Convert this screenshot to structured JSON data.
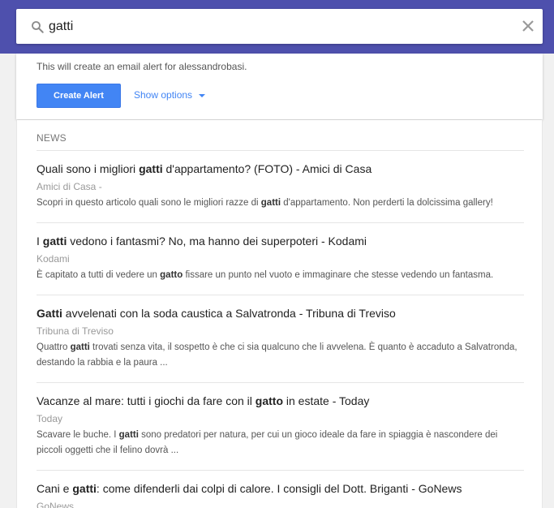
{
  "search": {
    "value": "gatti",
    "placeholder": ""
  },
  "alert": {
    "message": "This will create an email alert for alessandrobasi.",
    "create_label": "Create Alert",
    "options_label": "Show options"
  },
  "news": {
    "section_label": "NEWS",
    "items": [
      {
        "title": [
          {
            "t": "Quali sono i migliori ",
            "b": false
          },
          {
            "t": "gatti",
            "b": true
          },
          {
            "t": " d'appartamento? (FOTO) - Amici di Casa",
            "b": false
          }
        ],
        "source": "Amici di Casa -",
        "snippet": [
          {
            "t": "Scopri in questo articolo quali sono le migliori razze di ",
            "b": false
          },
          {
            "t": "gatti",
            "b": true
          },
          {
            "t": " d'appartamento. Non perderti la dolcissima gallery!",
            "b": false
          }
        ]
      },
      {
        "title": [
          {
            "t": "I ",
            "b": false
          },
          {
            "t": "gatti",
            "b": true
          },
          {
            "t": " vedono i fantasmi? No, ma hanno dei superpoteri - Kodami",
            "b": false
          }
        ],
        "source": "Kodami",
        "snippet": [
          {
            "t": "È capitato a tutti di vedere un ",
            "b": false
          },
          {
            "t": "gatto",
            "b": true
          },
          {
            "t": " fissare un punto nel vuoto e immaginare che stesse vedendo un fantasma.",
            "b": false
          }
        ]
      },
      {
        "title": [
          {
            "t": "Gatti",
            "b": true
          },
          {
            "t": " avvelenati con la soda caustica a Salvatronda - Tribuna di Treviso",
            "b": false
          }
        ],
        "source": "Tribuna di Treviso",
        "snippet": [
          {
            "t": "Quattro ",
            "b": false
          },
          {
            "t": "gatti",
            "b": true
          },
          {
            "t": " trovati senza vita, il sospetto è che ci sia qualcuno che li avvelena. È quanto è accaduto a Salvatronda, destando la rabbia e la paura ...",
            "b": false
          }
        ]
      },
      {
        "title": [
          {
            "t": "Vacanze al mare: tutti i giochi da fare con il ",
            "b": false
          },
          {
            "t": "gatto",
            "b": true
          },
          {
            "t": " in estate - Today",
            "b": false
          }
        ],
        "source": "Today",
        "snippet": [
          {
            "t": "Scavare le buche. I ",
            "b": false
          },
          {
            "t": "gatti",
            "b": true
          },
          {
            "t": " sono predatori per natura, per cui un gioco ideale da fare in spiaggia è nascondere dei piccoli oggetti che il felino dovrà ...",
            "b": false
          }
        ]
      },
      {
        "title": [
          {
            "t": "Cani e ",
            "b": false
          },
          {
            "t": "gatti",
            "b": true
          },
          {
            "t": ": come difenderli dai colpi di calore. I consigli del Dott. Briganti - GoNews",
            "b": false
          }
        ],
        "source": "GoNews",
        "snippet": []
      }
    ]
  },
  "colors": {
    "header_band": "#4e50ad",
    "accent": "#4285f4"
  },
  "icons": {
    "search": "search-icon",
    "clear": "close-icon",
    "dropdown": "caret-down-icon"
  }
}
